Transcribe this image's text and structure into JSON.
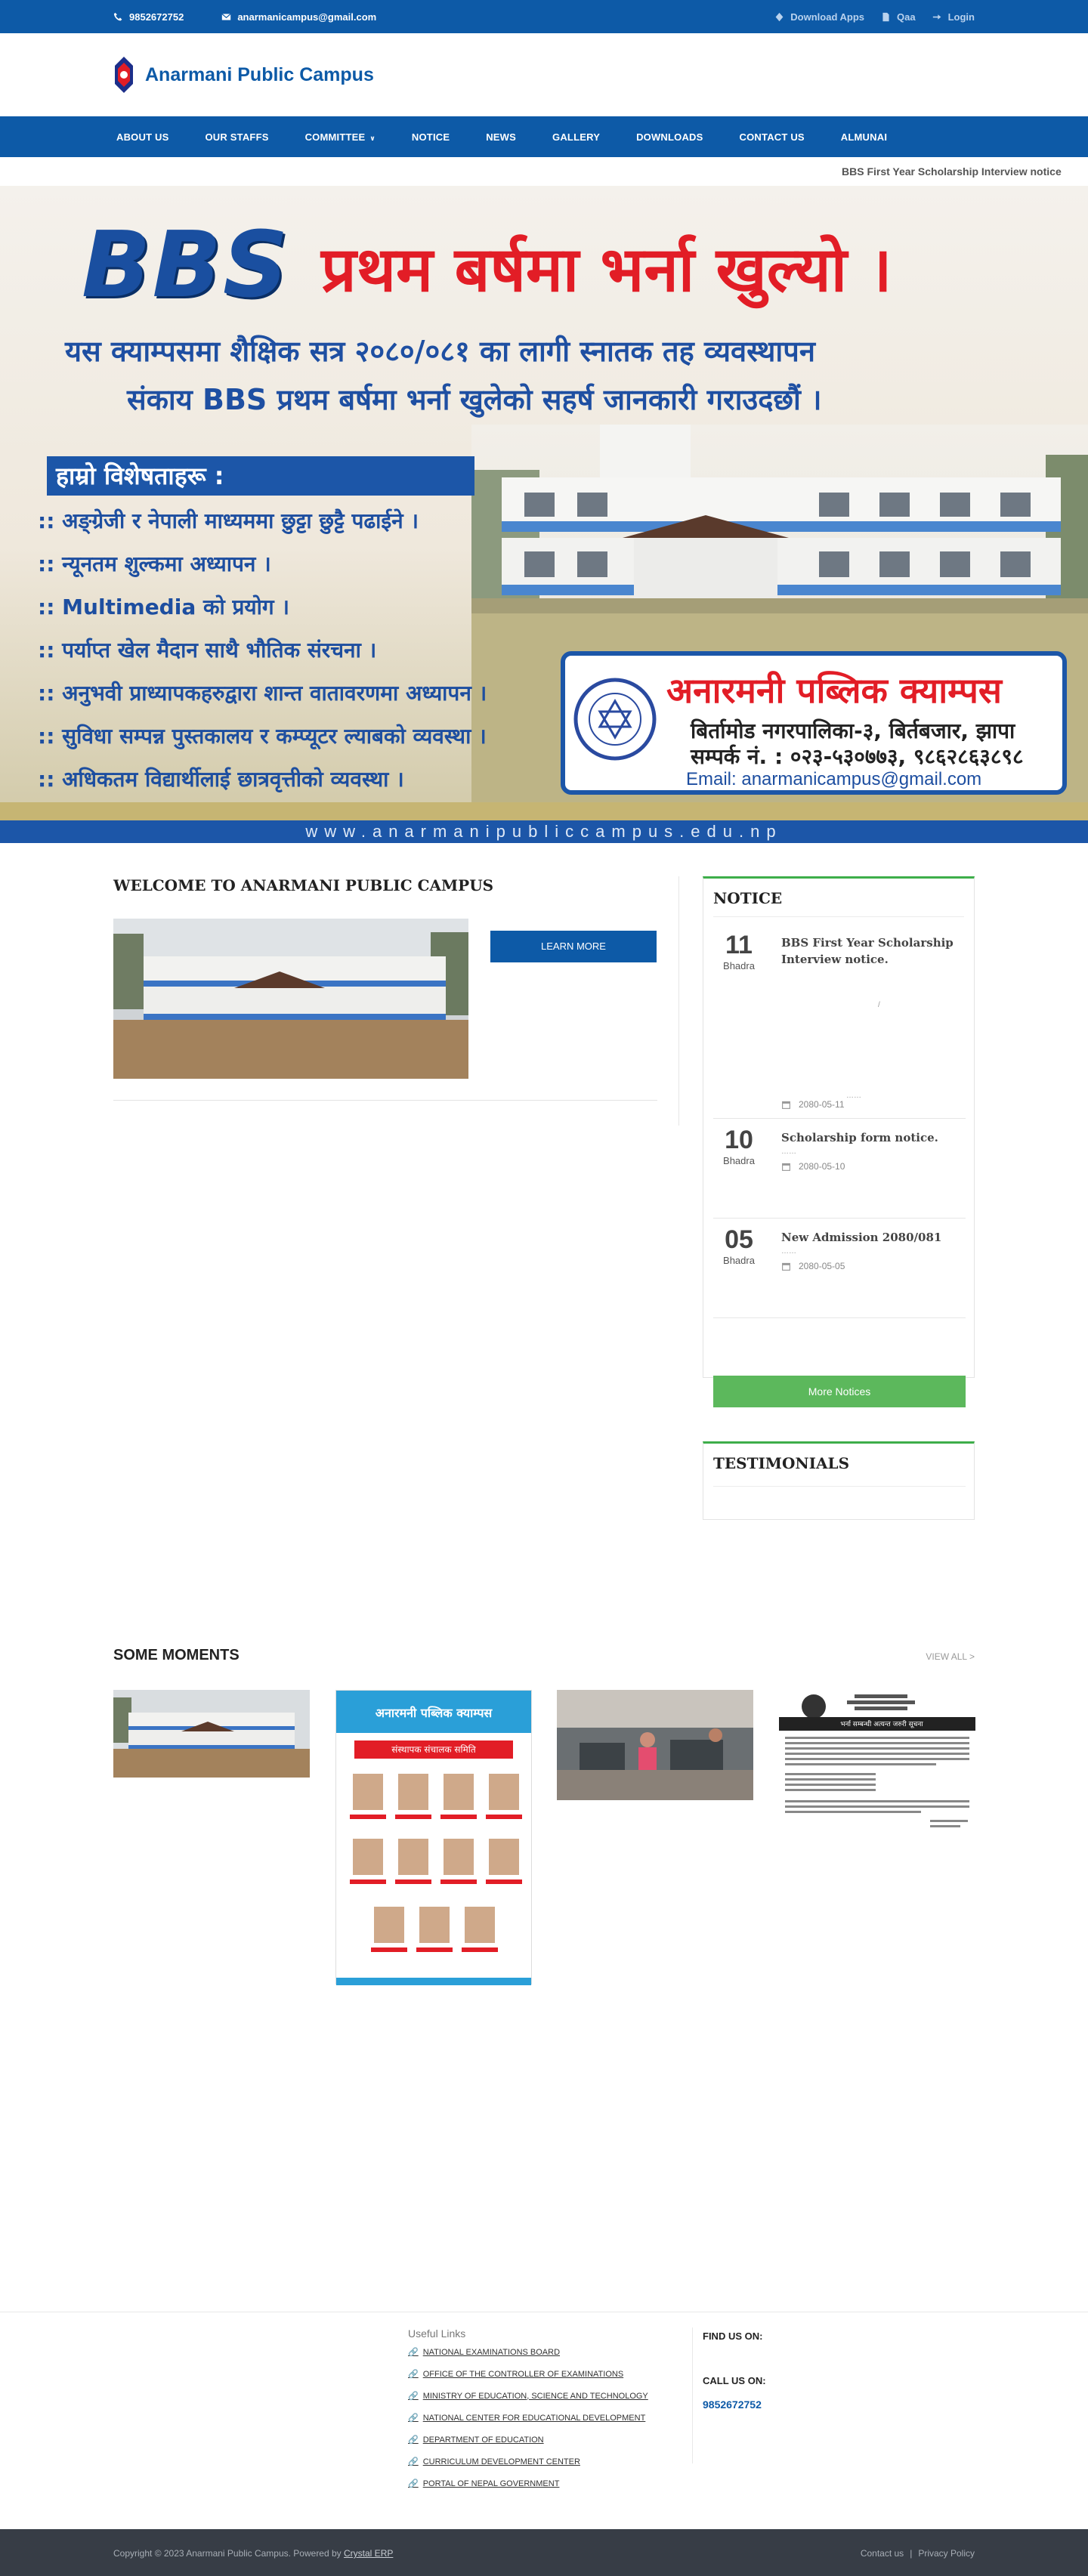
{
  "topbar": {
    "phone": "9852672752",
    "email": "anarmanicampus@gmail.com",
    "download": "Download Apps",
    "qaa": "Qaa",
    "login": "Login"
  },
  "brand": {
    "name": "Anarmani Public Campus"
  },
  "nav": {
    "items": [
      "ABOUT US",
      "OUR STAFFS",
      "COMMITTEE",
      "NOTICE",
      "NEWS",
      "GALLERY",
      "DOWNLOADS",
      "CONTACT US",
      "ALMUNAI"
    ]
  },
  "ticker": {
    "text": "BBS First Year Scholarship Interview notice"
  },
  "banner": {
    "bbs": "BBS",
    "headline": "प्रथम बर्षमा भर्ना खुल्यो ।",
    "sub1": "यस क्याम्पसमा शैक्षिक सत्र २०८०/०८१ का लागी स्नातक तह व्यवस्थापन",
    "sub2": "संकाय BBS प्रथम बर्षमा भर्ना खुलेको सहर्ष जानकारी गराउदछौं ।",
    "features_head": "हाम्रो विशेषताहरू :",
    "features": [
      ":: अङ्ग्रेजी र नेपाली माध्यममा छुट्टा छुट्टै पढाईने ।",
      ":: न्यूनतम शुल्कमा अध्यापन ।",
      ":: Multimedia को प्रयोग ।",
      ":: पर्याप्त खेल मैदान साथै भौतिक संरचना ।",
      ":: अनुभवी प्राध्यापकहरुद्वारा शान्त वातावरणमा अध्यापन ।",
      ":: सुविधा सम्पन्न पुस्तकालय र कम्प्यूटर ल्याबको व्यवस्था ।",
      ":: अधिकतम विद्यार्थीलाई छात्रवृत्तीको व्यवस्था ।"
    ],
    "card_name": "अनारमनी पब्लिक क्याम्पस",
    "card_address": "बिर्तामोड नगरपालिका-३, बिर्तबजार, झापा",
    "card_phone": "सम्पर्क नं. : ०२३-५३०७७३, ९८६२८६३८९८",
    "card_email": "Email: anarmanicampus@gmail.com",
    "website": "www.anarmanipubliccampus.edu.np"
  },
  "welcome": {
    "title": "WELCOME TO ANARMANI PUBLIC CAMPUS",
    "button": "LEARN MORE"
  },
  "notice": {
    "title": "NOTICE",
    "items": [
      {
        "day": "11",
        "month": "Bhadra",
        "title": "BBS First Year Scholarship Interview notice.",
        "date": "2080-05-11"
      },
      {
        "day": "10",
        "month": "Bhadra",
        "title": "Scholarship form notice.",
        "date": "2080-05-10"
      },
      {
        "day": "05",
        "month": "Bhadra",
        "title": "New Admission 2080/081",
        "date": "2080-05-05"
      }
    ],
    "more": "More Notices"
  },
  "testimonials": {
    "title": "TESTIMONIALS"
  },
  "moments": {
    "title": "SOME MOMENTS",
    "view_all": "VIEW ALL >",
    "poster_name": "अनारमनी पब्लिक क्याम्पस",
    "poster_committee": "संस्थापक संचालक समिति",
    "doc_heading": "भर्ना सम्बन्धी अत्यन्त जरुरी सूचना"
  },
  "footer": {
    "useful_title": "Useful Links",
    "links": [
      "NATIONAL EXAMINATIONS BOARD",
      "OFFICE OF THE CONTROLLER OF EXAMINATIONS",
      "MINISTRY OF EDUCATION, SCIENCE AND TECHNOLOGY",
      "NATIONAL CENTER FOR EDUCATIONAL DEVELOPMENT",
      "DEPARTMENT OF EDUCATION",
      "CURRICULUM DEVELOPMENT CENTER",
      "PORTAL OF NEPAL GOVERNMENT"
    ],
    "find_us": "FIND US ON:",
    "call_us": "CALL US ON:",
    "phone": "9852672752",
    "copyright": "Copyright © 2023 Anarmani Public Campus. Powered by",
    "powered": "Crystal ERP",
    "contact": "Contact us",
    "privacy": "Privacy Policy"
  },
  "colors": {
    "primary": "#0d5aa7",
    "green": "#5cb85c",
    "red": "#e21d26",
    "footer_dark": "#373d46"
  }
}
